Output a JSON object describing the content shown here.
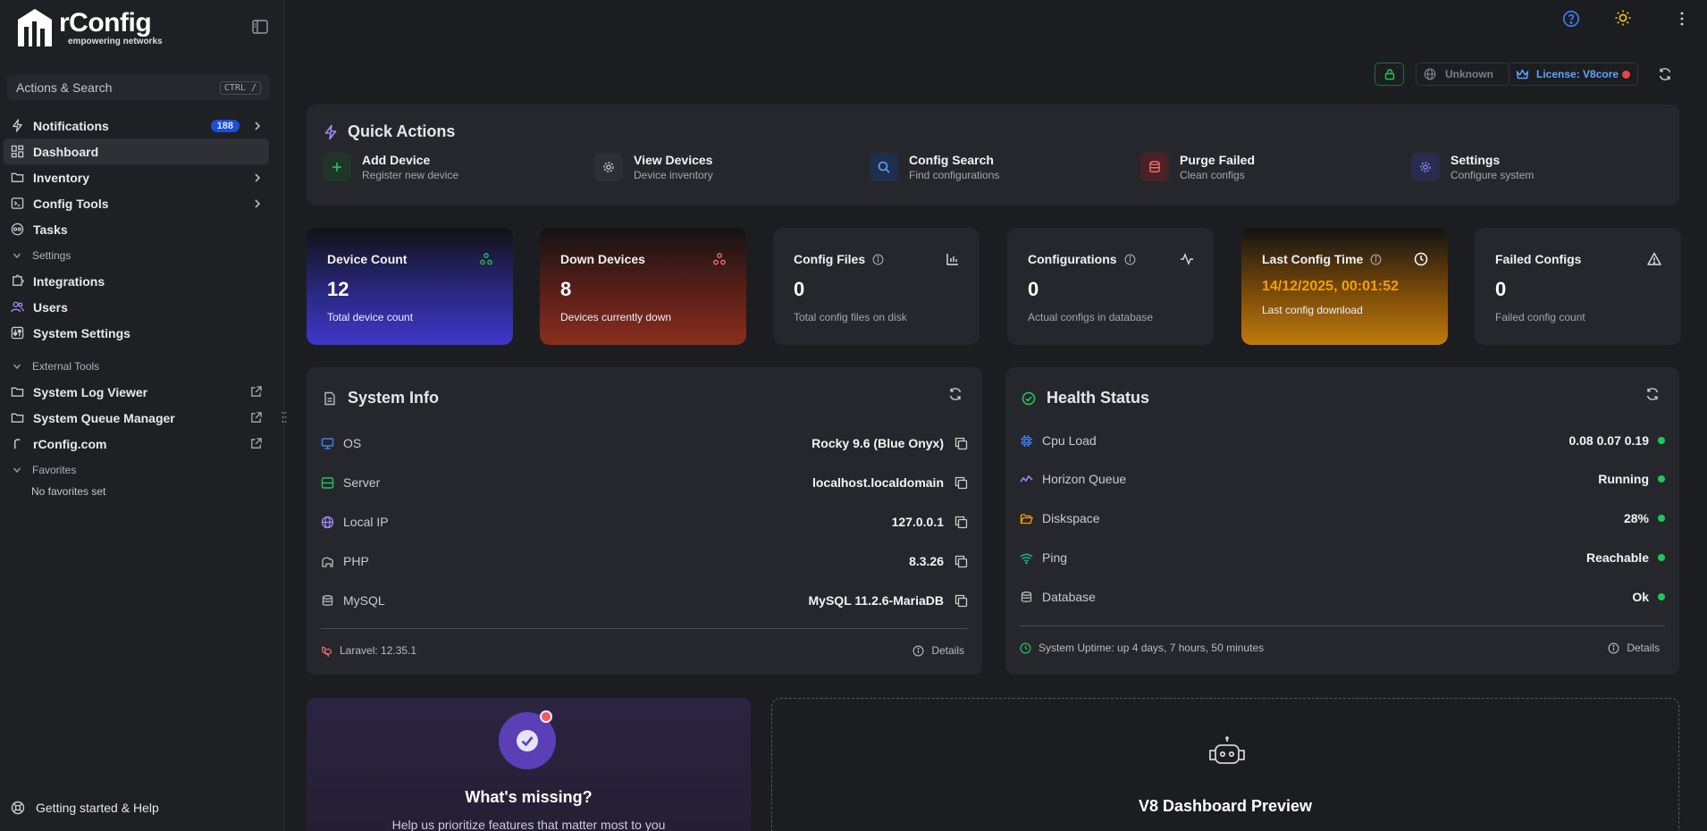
{
  "brand": {
    "name": "rConfig",
    "tagline": "empowering networks"
  },
  "search": {
    "label": "Actions & Search",
    "shortcut": "CTRL /"
  },
  "nav": {
    "notifications": {
      "label": "Notifications",
      "badge": "188"
    },
    "dashboard": "Dashboard",
    "inventory": "Inventory",
    "config_tools": "Config Tools",
    "tasks": "Tasks",
    "settings_group": "Settings",
    "integrations": "Integrations",
    "users": "Users",
    "system_settings": "System Settings",
    "external_group": "External Tools",
    "log_viewer": "System Log Viewer",
    "queue_manager": "System Queue Manager",
    "rconfig_com": "rConfig.com",
    "favorites_group": "Favorites",
    "favorites_empty": "No favorites set",
    "help": "Getting started & Help"
  },
  "topbar": {
    "network_status": "Unknown",
    "license": "License: V8core"
  },
  "colors": {
    "accent": "#1d4ed8",
    "success": "#22c55e",
    "danger": "#ef4444",
    "warning": "#f59e0b",
    "license": "#60a5fa"
  },
  "quick_actions": {
    "title": "Quick Actions",
    "items": [
      {
        "title": "Add Device",
        "subtitle": "Register new device",
        "icon": "plus-icon"
      },
      {
        "title": "View Devices",
        "subtitle": "Device inventory",
        "icon": "gear-icon"
      },
      {
        "title": "Config Search",
        "subtitle": "Find configurations",
        "icon": "search-icon"
      },
      {
        "title": "Purge Failed",
        "subtitle": "Clean configs",
        "icon": "database-icon"
      },
      {
        "title": "Settings",
        "subtitle": "Configure system",
        "icon": "gear-icon"
      }
    ]
  },
  "stats": [
    {
      "title": "Device Count",
      "value": "12",
      "subtitle": "Total device count"
    },
    {
      "title": "Down Devices",
      "value": "8",
      "subtitle": "Devices currently down"
    },
    {
      "title": "Config Files",
      "value": "0",
      "subtitle": "Total config files on disk"
    },
    {
      "title": "Configurations",
      "value": "0",
      "subtitle": "Actual configs in database"
    },
    {
      "title": "Last Config Time",
      "value": "14/12/2025, 00:01:52",
      "subtitle": "Last config download"
    },
    {
      "title": "Failed Configs",
      "value": "0",
      "subtitle": "Failed config count"
    }
  ],
  "system_info": {
    "title": "System Info",
    "rows": [
      {
        "key": "OS",
        "value": "Rocky 9.6 (Blue Onyx)"
      },
      {
        "key": "Server",
        "value": "localhost.localdomain"
      },
      {
        "key": "Local IP",
        "value": "127.0.0.1"
      },
      {
        "key": "PHP",
        "value": "8.3.26"
      },
      {
        "key": "MySQL",
        "value": "MySQL 11.2.6-MariaDB"
      }
    ],
    "footer": "Laravel: 12.35.1",
    "details": "Details"
  },
  "health": {
    "title": "Health Status",
    "rows": [
      {
        "key": "Cpu Load",
        "value": "0.08 0.07 0.19"
      },
      {
        "key": "Horizon Queue",
        "value": "Running"
      },
      {
        "key": "Diskspace",
        "value": "28%"
      },
      {
        "key": "Ping",
        "value": "Reachable"
      },
      {
        "key": "Database",
        "value": "Ok"
      }
    ],
    "uptime": "System Uptime: up 4 days, 7 hours, 50 minutes",
    "details": "Details"
  },
  "missing": {
    "title": "What's missing?",
    "text": "Help us prioritize features that matter most to you"
  },
  "preview": {
    "title": "V8 Dashboard Preview"
  }
}
